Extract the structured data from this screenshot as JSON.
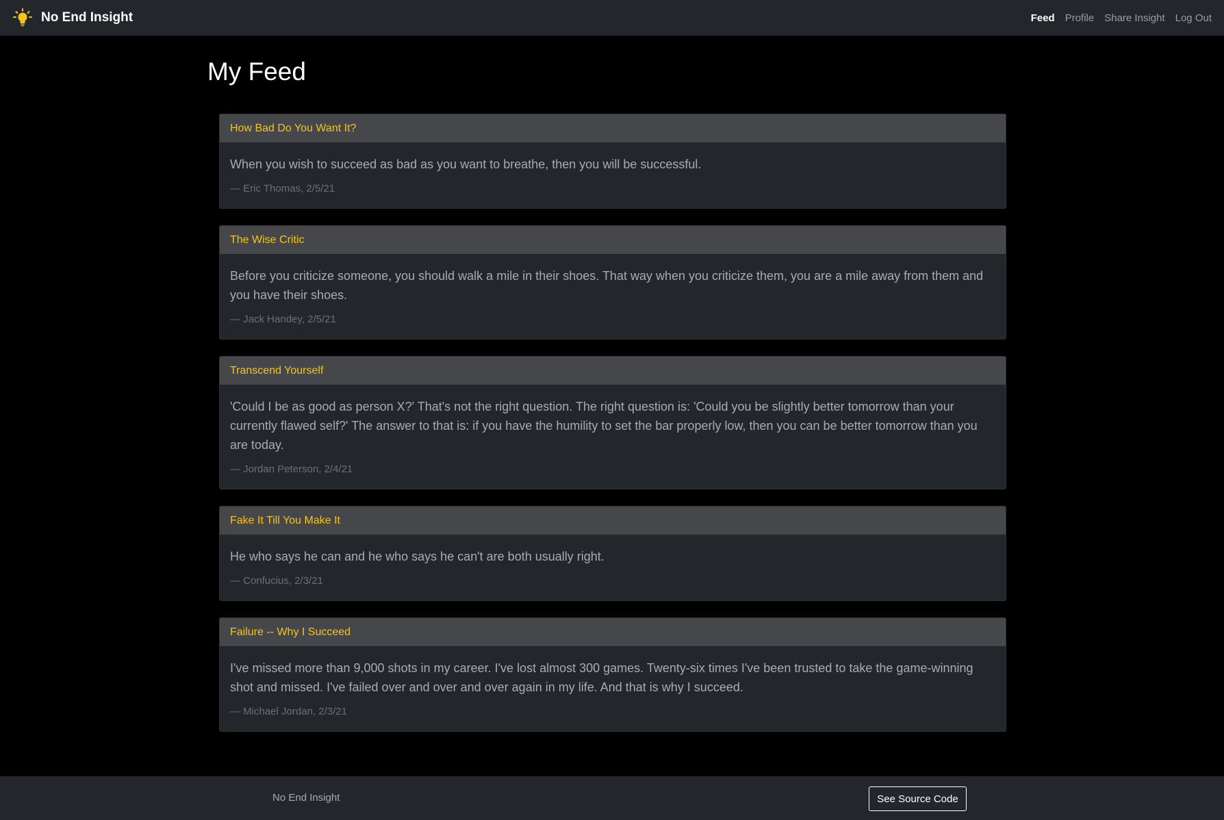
{
  "navbar": {
    "brand": "No End Insight",
    "links": [
      {
        "label": "Feed",
        "active": true
      },
      {
        "label": "Profile",
        "active": false
      },
      {
        "label": "Share Insight",
        "active": false
      },
      {
        "label": "Log Out",
        "active": false
      }
    ]
  },
  "page_title": "My Feed",
  "posts": [
    {
      "title": "How Bad Do You Want It?",
      "quote": "When you wish to succeed as bad as you want to breathe, then you will be successful.",
      "attribution": "— Eric Thomas, 2/5/21"
    },
    {
      "title": "The Wise Critic",
      "quote": "Before you criticize someone, you should walk a mile in their shoes. That way when you criticize them, you are a mile away from them and you have their shoes.",
      "attribution": "— Jack Handey, 2/5/21"
    },
    {
      "title": "Transcend Yourself",
      "quote": "'Could I be as good as person X?' That's not the right question. The right question is: 'Could you be slightly better tomorrow than your currently flawed self?' The answer to that is: if you have the humility to set the bar properly low, then you can be better tomorrow than you are today.",
      "attribution": "— Jordan Peterson, 2/4/21"
    },
    {
      "title": "Fake It Till You Make It",
      "quote": "He who says he can and he who says he can't are both usually right.",
      "attribution": "— Confucius, 2/3/21"
    },
    {
      "title": "Failure -- Why I Succeed",
      "quote": "I've missed more than 9,000 shots in my career. I've lost almost 300 games. Twenty-six times I've been trusted to take the game-winning shot and missed. I've failed over and over and over again in my life. And that is why I succeed.",
      "attribution": "— Michael Jordan, 2/3/21"
    }
  ],
  "footer": {
    "brand": "No End Insight",
    "source_button": "See Source Code"
  },
  "colors": {
    "page_background": "#000000",
    "navbar_background": "#23262b",
    "card_background": "#23262b",
    "card_header_background": "#45474a",
    "accent_title": "#f5c518",
    "body_text": "#a9acaf",
    "muted_text": "#6c6f73"
  },
  "icons": {
    "brand": "lightbulb-icon"
  }
}
